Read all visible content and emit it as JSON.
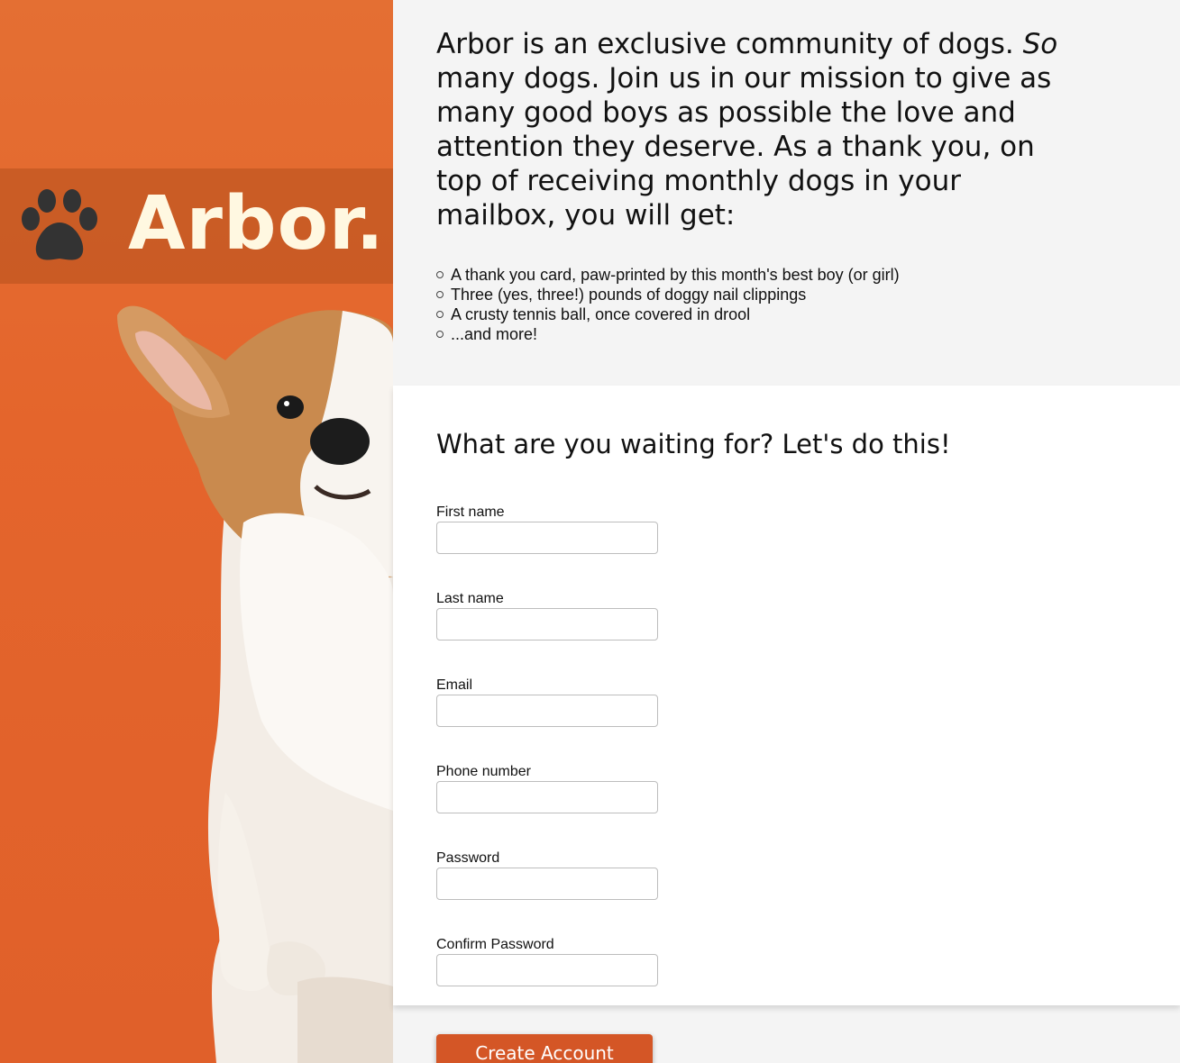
{
  "hero": {
    "brand": "Arbor.",
    "colors": {
      "background": "#e4652c",
      "band": "#b4501e",
      "paw": "#333333",
      "brand_text": "#fff8e1"
    }
  },
  "intro": {
    "text_before": "Arbor is an exclusive community of dogs. ",
    "emphasis": "So",
    "text_after": " many dogs. Join us in our mission to give as many good boys as possible the love and attention they deserve. As a thank you, on top of receiving monthly dogs in your mailbox, you will get:"
  },
  "perks": [
    "A thank you card, paw-printed by this month's best boy (or girl)",
    "Three (yes, three!) pounds of doggy nail clippings",
    "A crusty tennis ball, once covered in drool",
    "...and more!"
  ],
  "form": {
    "title": "What are you waiting for? Let's do this!",
    "fields": [
      {
        "label": "First name",
        "value": ""
      },
      {
        "label": "Last name",
        "value": ""
      },
      {
        "label": "Email",
        "value": ""
      },
      {
        "label": "Phone number",
        "value": ""
      },
      {
        "label": "Password",
        "value": ""
      },
      {
        "label": "Confirm Password",
        "value": ""
      }
    ],
    "submit_label": "Create Account",
    "accent_color": "#d45626"
  }
}
